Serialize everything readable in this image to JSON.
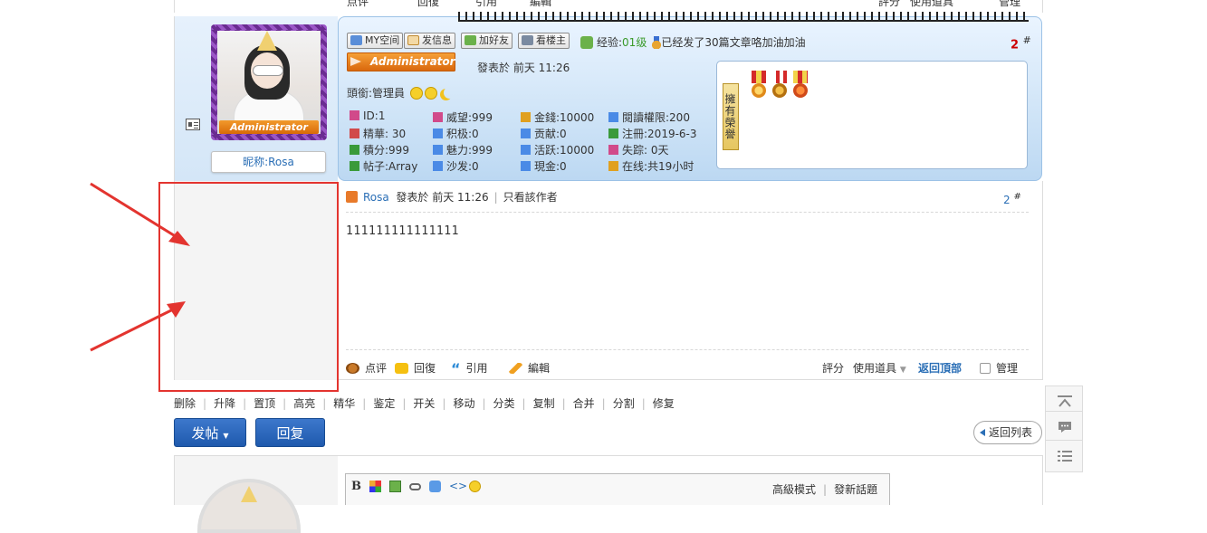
{
  "top_row": {
    "comment": "点评",
    "reply": "回復",
    "quote": "引用",
    "edit": "編輯",
    "rate": "評分",
    "use_tool": "使用道具",
    "manage": "管理"
  },
  "author": {
    "avatar_badge": "Administrator",
    "nickname_label": "昵称:Rosa",
    "buttons": {
      "my_space": "MY空间",
      "send_msg": "发信息",
      "add_friend": "加好友",
      "view_owner": "看楼主"
    },
    "exp_label": "经验:",
    "exp_level": "01级",
    "medal_text": "已经发了30篇文章咯加油加油",
    "floor_no": "2",
    "floor_mark": "#",
    "rank_badge": "Administrator",
    "posted_at": "發表於 前天 11:26",
    "title_label": "頭銜:管理員",
    "stats": [
      {
        "label": "ID:1",
        "color": "#d14a8a"
      },
      {
        "label": "威望:999",
        "color": "#d14a8a"
      },
      {
        "label": "金錢:10000",
        "color": "#e0a020"
      },
      {
        "label": "閱讀權限:200",
        "color": "#4a8ae6"
      },
      {
        "label": "精華: 30",
        "color": "#d14a4a"
      },
      {
        "label": "积极:0",
        "color": "#4a8ae6"
      },
      {
        "label": "贡献:0",
        "color": "#4a8ae6"
      },
      {
        "label": "注冊:2019-6-3",
        "color": "#3a9a3a"
      },
      {
        "label": "積分:999",
        "color": "#3a9a3a"
      },
      {
        "label": "魅力:999",
        "color": "#4a8ae6"
      },
      {
        "label": "活跃:10000",
        "color": "#4a8ae6"
      },
      {
        "label": "失踪: 0天",
        "color": "#d14a8a"
      },
      {
        "label": "帖子:Array",
        "color": "#3a9a3a"
      },
      {
        "label": "沙发:0",
        "color": "#4a8ae6"
      },
      {
        "label": "現金:0",
        "color": "#4a8ae6"
      },
      {
        "label": "在线:共19小时",
        "color": "#e0a020"
      }
    ],
    "honor_label": "擁有榮譽"
  },
  "post": {
    "username": "Rosa",
    "posted_at": "發表於 前天 11:26",
    "only_author": "只看該作者",
    "floor_no": "2",
    "floor_mark": "#",
    "content": "111111111111111",
    "actions": {
      "comment": "点评",
      "reply": "回復",
      "quote": "引用",
      "edit": "編輯",
      "rate": "評分",
      "use_tool": "使用道具",
      "back_top": "返回頂部",
      "manage": "管理"
    }
  },
  "admin_links": [
    "删除",
    "升降",
    "置顶",
    "高亮",
    "精华",
    "鉴定",
    "开关",
    "移动",
    "分类",
    "复制",
    "合并",
    "分割",
    "修复"
  ],
  "buttons": {
    "new_post": "发帖",
    "reply": "回复",
    "back_list": "返回列表"
  },
  "editor": {
    "bold": "B",
    "advanced_mode": "高級模式",
    "new_topic": "發新話題"
  },
  "colors": {
    "link_blue": "#2b6fb6",
    "accent_orange": "#d8650a",
    "annotation_red": "#e3342f",
    "button_blue": "#1f5aad"
  }
}
